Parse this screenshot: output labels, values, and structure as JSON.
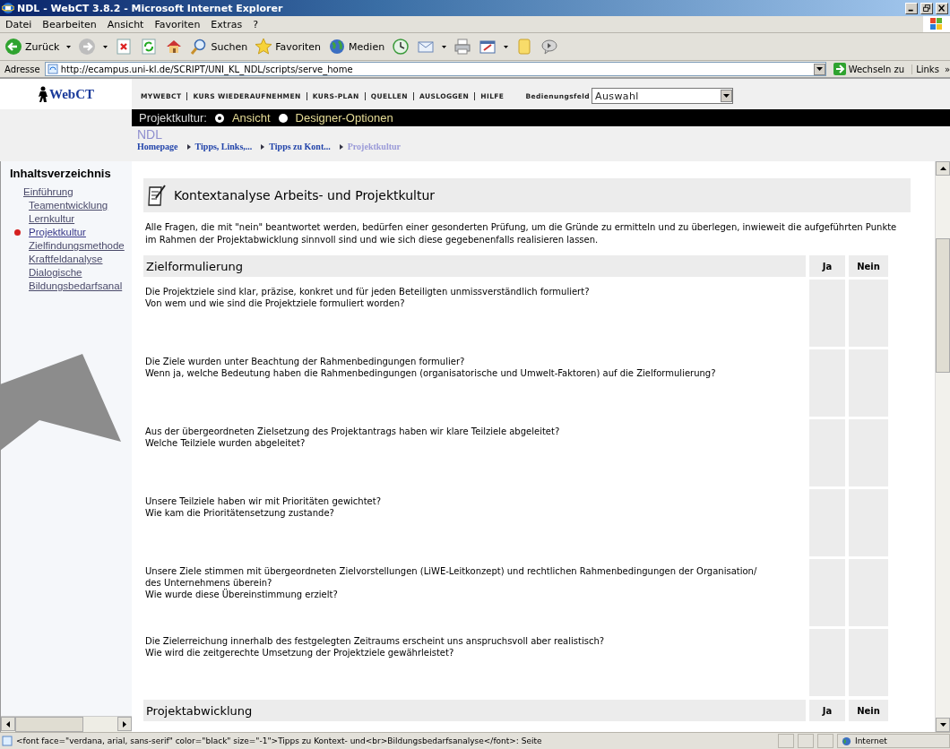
{
  "window": {
    "title": "NDL - WebCT 3.8.2 - Microsoft Internet Explorer"
  },
  "menu": [
    "Datei",
    "Bearbeiten",
    "Ansicht",
    "Favoriten",
    "Extras",
    "?"
  ],
  "toolbar": [
    {
      "kind": "back",
      "label": "Zurück"
    },
    {
      "kind": "forward"
    },
    {
      "kind": "stop"
    },
    {
      "kind": "refresh"
    },
    {
      "kind": "home"
    },
    {
      "kind": "search",
      "label": "Suchen"
    },
    {
      "kind": "favorites",
      "label": "Favoriten"
    },
    {
      "kind": "media",
      "label": "Medien"
    },
    {
      "kind": "history"
    },
    {
      "kind": "mail"
    },
    {
      "kind": "print"
    },
    {
      "kind": "edit"
    },
    {
      "kind": "folder"
    },
    {
      "kind": "messenger"
    }
  ],
  "address": {
    "label": "Adresse",
    "value": "http://ecampus.uni-kl.de/SCRIPT/UNI_KL_NDL/scripts/serve_home",
    "go": "Wechseln zu",
    "links": "Links",
    "more": "»"
  },
  "webct": {
    "logo": "WebCT",
    "nav": [
      "MYWEBCT",
      "KURS WIEDERAUFNEHMEN",
      "KURS-PLAN",
      "QUELLEN",
      "AUSLOGGEN",
      "HILFE"
    ],
    "panel_label": "Bedienungsfeld",
    "panel_value": "Auswahl"
  },
  "modebar": {
    "label": "Projektkultur:",
    "options": [
      {
        "label": "Ansicht",
        "selected": true
      },
      {
        "label": "Designer-Optionen",
        "selected": false
      }
    ]
  },
  "course": "NDL",
  "breadcrumb": [
    {
      "label": "Homepage",
      "current": false
    },
    {
      "label": "Tipps, Links,...",
      "current": false
    },
    {
      "label": "Tipps zu Kont...",
      "current": false
    },
    {
      "label": "Projektkultur",
      "current": true
    }
  ],
  "sidebar": {
    "title": "Inhaltsverzeichnis",
    "items": [
      {
        "label": "Einführung",
        "selected": false,
        "children": [
          {
            "label": "Teamentwicklung",
            "selected": false
          },
          {
            "label": "Lernkultur",
            "selected": false
          },
          {
            "label": "Projektkultur",
            "selected": true
          },
          {
            "label": "Zielfindungsmethode",
            "selected": false
          },
          {
            "label": "Kraftfeldanalyse",
            "selected": false
          },
          {
            "label": "Dialogische Bildungsbedarfsanal",
            "selected": false
          }
        ]
      }
    ]
  },
  "page": {
    "title": "Kontextanalyse Arbeits- und Projektkultur",
    "intro": "Alle Fragen, die mit \"nein\" beantwortet werden, bedürfen einer gesonderten Prüfung, um die Gründe zu ermitteln und zu überlegen, inwieweit die aufgeführten Punkte im Rahmen der Projektabwicklung sinnvoll sind und wie sich diese gegebenenfalls realisieren lassen.",
    "sections": [
      {
        "title": "Zielformulierung",
        "columns": [
          "Ja",
          "Nein"
        ],
        "rows": [
          {
            "lines": [
              "Die Projektziele sind klar, präzise, konkret und für jeden Beteiligten unmissverständlich formuliert?",
              "Von wem und wie sind die Projektziele formuliert worden?"
            ]
          },
          {
            "lines": [
              "Die Ziele wurden unter Beachtung der Rahmenbedingungen formulier?",
              "Wenn ja, welche Bedeutung haben die Rahmenbedingungen (organisatorische und Umwelt-Faktoren) auf die Zielformulierung?"
            ]
          },
          {
            "lines": [
              "Aus der übergeordneten Zielsetzung des Projektantrags haben wir klare Teilziele abgeleitet?",
              "Welche Teilziele wurden abgeleitet?"
            ]
          },
          {
            "lines": [
              "Unsere Teilziele haben wir mit Prioritäten gewichtet?",
              "Wie kam die Prioritätensetzung zustande?"
            ]
          },
          {
            "lines": [
              "Unsere Ziele stimmen mit übergeordneten Zielvorstellungen (LiWE-Leitkonzept) und rechtlichen Rahmenbedingungen der Organisation/",
              "des Unternehmens überein?",
              "Wie wurde diese Übereinstimmung erzielt?"
            ]
          },
          {
            "lines": [
              "Die Zielerreichung innerhalb des festgelegten Zeitraums erscheint uns anspruchsvoll aber realistisch?",
              "Wie wird die zeitgerechte Umsetzung der Projektziele gewährleistet?"
            ]
          }
        ]
      },
      {
        "title": "Projektabwicklung",
        "columns": [
          "Ja",
          "Nein"
        ]
      }
    ]
  },
  "status_bar": {
    "text": "<font face=\"verdana, arial, sans-serif\" color=\"black\" size=\"-1\">Tipps zu Kontext- und<br>Bildungsbedarfsanalyse</font>: Seite",
    "zone": "Internet"
  }
}
